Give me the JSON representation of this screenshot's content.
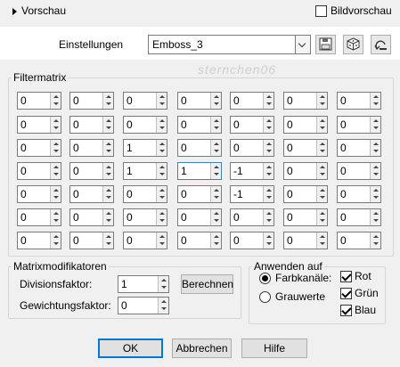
{
  "header": {
    "title": "Vorschau",
    "preview_checkbox_label": "Bildvorschau",
    "preview_checked": false
  },
  "settings": {
    "label": "Einstellungen",
    "preset_value": "Emboss_3",
    "save_icon": "floppy-disk-icon",
    "random_icon": "dice-icon",
    "reset_icon": "reset-icon"
  },
  "matrix": {
    "legend": "Filtermatrix",
    "watermark": "sternchen06",
    "rows": [
      [
        "0",
        "0",
        "0",
        "0",
        "0",
        "0",
        "0"
      ],
      [
        "0",
        "0",
        "0",
        "0",
        "0",
        "0",
        "0"
      ],
      [
        "0",
        "0",
        "1",
        "0",
        "0",
        "0",
        "0"
      ],
      [
        "0",
        "0",
        "1",
        "1",
        "-1",
        "0",
        "0"
      ],
      [
        "0",
        "0",
        "0",
        "0",
        "-1",
        "0",
        "0"
      ],
      [
        "0",
        "0",
        "0",
        "0",
        "0",
        "0",
        "0"
      ],
      [
        "0",
        "0",
        "0",
        "0",
        "0",
        "0",
        "0"
      ]
    ]
  },
  "modifiers": {
    "legend": "Matrixmodifikatoren",
    "divisor_label": "Divisionsfaktor:",
    "divisor_value": "1",
    "compute_button": "Berechnen",
    "bias_label": "Gewichtungsfaktor:",
    "bias_value": "0"
  },
  "apply": {
    "legend": "Anwenden auf",
    "radio_channels": "Farbkanäle:",
    "radio_gray": "Grauwerte",
    "selected": "Farbkanäle:",
    "red": "Rot",
    "green": "Grün",
    "blue": "Blau"
  },
  "footer": {
    "ok": "OK",
    "cancel": "Abbrechen",
    "help": "Hilfe"
  }
}
